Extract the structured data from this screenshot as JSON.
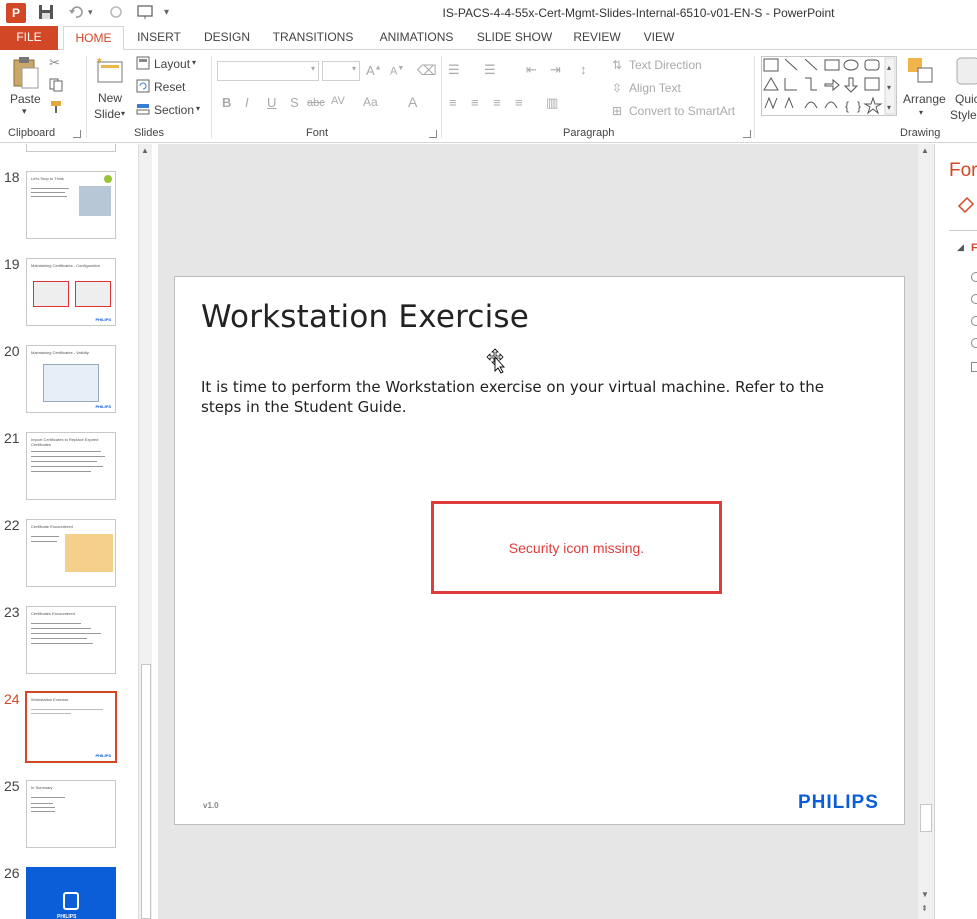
{
  "app": {
    "window_title": "IS-PACS-4-4-55x-Cert-Mgmt-Slides-Internal-6510-v01-EN-S - PowerPoint",
    "icon_letter": "P"
  },
  "tabs": [
    {
      "label": "FILE"
    },
    {
      "label": "HOME"
    },
    {
      "label": "INSERT"
    },
    {
      "label": "DESIGN"
    },
    {
      "label": "TRANSITIONS"
    },
    {
      "label": "ANIMATIONS"
    },
    {
      "label": "SLIDE SHOW"
    },
    {
      "label": "REVIEW"
    },
    {
      "label": "VIEW"
    }
  ],
  "ribbon": {
    "clipboard": {
      "label": "Clipboard",
      "paste": "Paste"
    },
    "slides": {
      "label": "Slides",
      "new_slide_1": "New",
      "new_slide_2": "Slide",
      "layout": "Layout",
      "reset": "Reset",
      "section": "Section"
    },
    "font": {
      "label": "Font",
      "bold": "B",
      "italic": "I",
      "underline": "U",
      "shadow": "S",
      "strike": "abc",
      "spacing": "AV",
      "case": "Aa",
      "color": "A"
    },
    "paragraph": {
      "label": "Paragraph",
      "text_direction": "Text Direction",
      "align_text": "Align Text",
      "convert_smartart": "Convert to SmartArt"
    },
    "drawing": {
      "label": "Drawing",
      "arrange": "Arrange",
      "quick_styles_1": "Quic",
      "quick_styles_2": "Styles"
    }
  },
  "thumbnails": [
    {
      "num": "18",
      "title": "Let's Stop to Think"
    },
    {
      "num": "19",
      "title": "Maintaining Certificates - Configuration"
    },
    {
      "num": "20",
      "title": "Maintaining Certificates - Validity"
    },
    {
      "num": "21",
      "title": "Import Certificates to Replace Expired Certificates"
    },
    {
      "num": "22",
      "title": "Certificate Encountered"
    },
    {
      "num": "23",
      "title": "Certificates Encountered"
    },
    {
      "num": "24",
      "title": "Workstation Exercise"
    },
    {
      "num": "25",
      "title": "In Summary"
    },
    {
      "num": "26",
      "title": ""
    }
  ],
  "slide": {
    "title": "Workstation Exercise",
    "body": "It is time to perform the Workstation exercise on your virtual machine. Refer to the steps in the Student Guide.",
    "missing_label": "Security icon missing.",
    "version": "v1.0",
    "logo": "PHILIPS"
  },
  "format_pane": {
    "title": "For",
    "section": "F"
  }
}
